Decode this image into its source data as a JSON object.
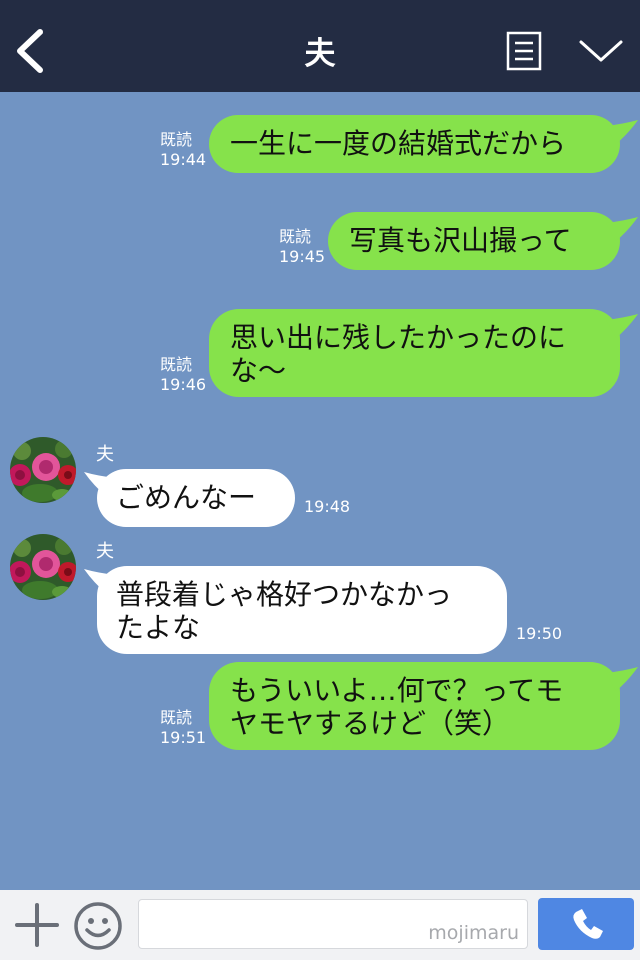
{
  "header": {
    "title": "夫",
    "back_icon": "chevron-left-icon",
    "notes_icon": "note-icon",
    "menu_icon": "chevron-down-icon",
    "background": "#232c43"
  },
  "chat": {
    "background": "#7194c3",
    "sent_bubble_color": "#86e24b",
    "received_bubble_color": "#ffffff",
    "messages": [
      {
        "from": "me",
        "text": "一生に一度の結婚式だから",
        "read": "既読",
        "time": "19:44"
      },
      {
        "from": "me",
        "text": "写真も沢山撮って",
        "read": "既読",
        "time": "19:45"
      },
      {
        "from": "me",
        "line1": "思い出に残したかったのに",
        "line2": "な〜",
        "read": "既読",
        "time": "19:46"
      },
      {
        "from": "them",
        "sender": "夫",
        "text": "ごめんなー",
        "time": "19:48"
      },
      {
        "from": "them",
        "sender": "夫",
        "line1": "普段着じゃ格好つかなかっ",
        "line2": "たよな",
        "time": "19:50"
      },
      {
        "from": "me",
        "line1": "もういいよ…何で？ってモ",
        "line2": "ヤモヤするけど（笑）",
        "read": "既読",
        "time": "19:51"
      }
    ]
  },
  "footer": {
    "plus_icon": "plus-icon",
    "emoji_icon": "smiley-icon",
    "input_value": "",
    "watermark": "mojimaru",
    "call_icon": "phone-icon",
    "call_color": "#4f87e3"
  }
}
